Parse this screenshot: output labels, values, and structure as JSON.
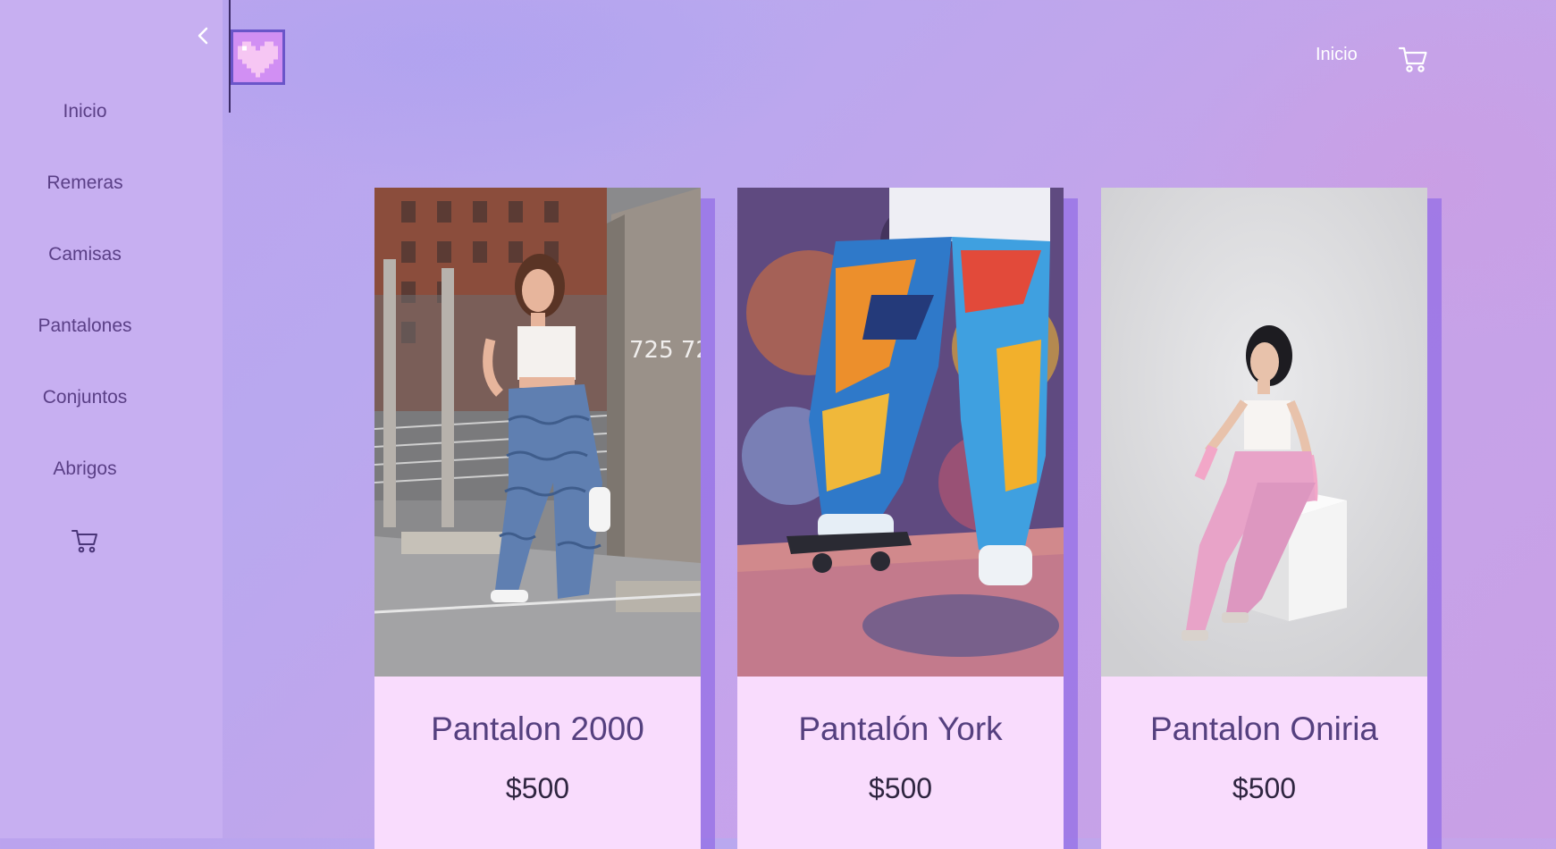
{
  "sidebar": {
    "toggle_icon": "chevron-left-icon",
    "items": [
      {
        "label": "Inicio"
      },
      {
        "label": "Remeras"
      },
      {
        "label": "Camisas"
      },
      {
        "label": "Pantalones"
      },
      {
        "label": "Conjuntos"
      },
      {
        "label": "Abrigos"
      }
    ],
    "cart_icon": "shopping-cart-icon"
  },
  "header": {
    "logo_icon": "pixel-heart-icon",
    "nav_label": "Inicio",
    "cart_icon": "shopping-cart-icon"
  },
  "products": [
    {
      "name": "Pantalon 2000",
      "price": "$500",
      "photo": "woman-in-wavy-blue-jeans-on-rooftop-photo"
    },
    {
      "name": "Pantalón York",
      "price": "$500",
      "photo": "graffiti-print-pants-on-skateboard-photo"
    },
    {
      "name": "Pantalon Oniria",
      "price": "$500",
      "photo": "woman-in-pink-pants-sitting-on-cube-photo"
    }
  ],
  "colors": {
    "background": "#bca6ee",
    "sidebar": "#c7aff1",
    "card": "#f9dcfd",
    "card_shadow": "#936ee6",
    "nav_text": "#5a3f86",
    "product_name": "#55407f",
    "price": "#2f2540"
  }
}
